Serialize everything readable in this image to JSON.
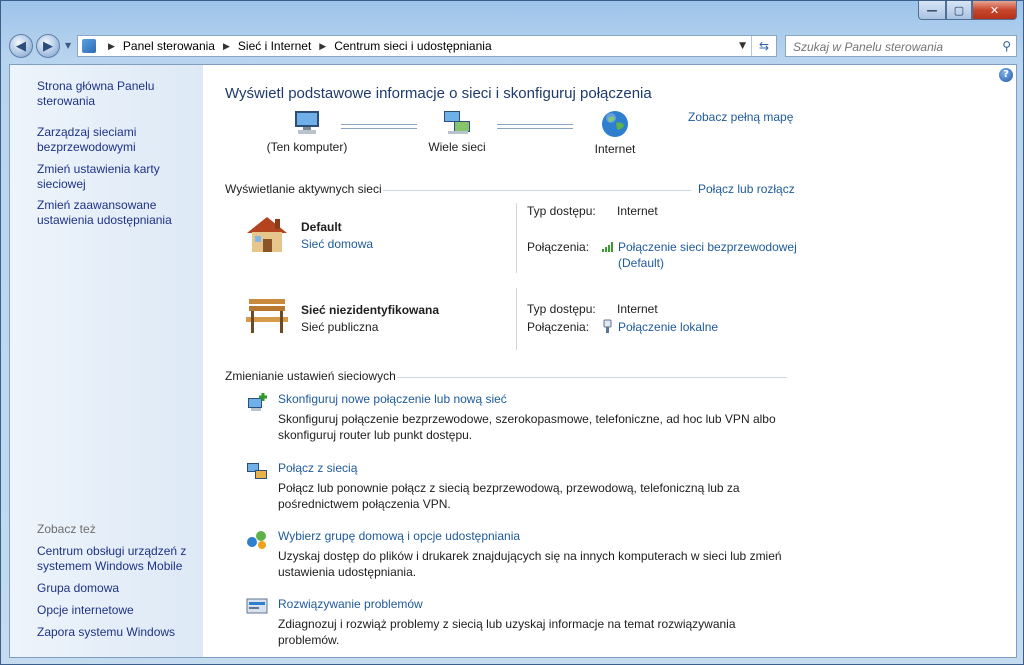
{
  "window": {
    "buttons": {
      "minimize": "—",
      "maximize": "▢",
      "close": "✕"
    }
  },
  "address": {
    "crumbs": [
      "Panel sterowania",
      "Sieć i Internet",
      "Centrum sieci i udostępniania"
    ]
  },
  "search": {
    "placeholder": "Szukaj w Panelu sterowania"
  },
  "sidebar": {
    "links": [
      "Strona główna Panelu sterowania",
      "Zarządzaj sieciami bezprzewodowymi",
      "Zmień ustawienia karty sieciowej",
      "Zmień zaawansowane ustawienia udostępniania"
    ],
    "see_also_label": "Zobacz też",
    "see_also": [
      "Centrum obsługi urządzeń z systemem Windows Mobile",
      "Grupa domowa",
      "Opcje internetowe",
      "Zapora systemu Windows"
    ]
  },
  "main": {
    "title": "Wyświetl podstawowe informacje o sieci i skonfiguruj połączenia",
    "full_map": "Zobacz pełną mapę",
    "map": {
      "computer": "(Ten komputer)",
      "networks": "Wiele sieci",
      "internet": "Internet"
    },
    "active_header": "Wyświetlanie aktywnych sieci",
    "connect_link": "Połącz lub rozłącz",
    "networks": [
      {
        "name": "Default",
        "type": "Sieć domowa",
        "access_label": "Typ dostępu:",
        "access": "Internet",
        "conn_label": "Połączenia:",
        "conn": "Połączenie sieci bezprzewodowej",
        "conn2": "(Default)"
      },
      {
        "name": "Sieć niezidentyfikowana",
        "type": "Sieć publiczna",
        "access_label": "Typ dostępu:",
        "access": "Internet",
        "conn_label": "Połączenia:",
        "conn": "Połączenie lokalne"
      }
    ],
    "change_header": "Zmienianie ustawień sieciowych",
    "tasks": [
      {
        "link": "Skonfiguruj nowe połączenie lub nową sieć",
        "desc": "Skonfiguruj połączenie bezprzewodowe, szerokopasmowe, telefoniczne, ad hoc lub VPN albo skonfiguruj router lub punkt dostępu."
      },
      {
        "link": "Połącz z siecią",
        "desc": "Połącz lub ponownie połącz z siecią bezprzewodową, przewodową, telefoniczną lub za pośrednictwem połączenia VPN."
      },
      {
        "link": "Wybierz grupę domową i opcje udostępniania",
        "desc": "Uzyskaj dostęp do plików i drukarek znajdujących się na innych komputerach w sieci lub zmień ustawienia udostępniania."
      },
      {
        "link": "Rozwiązywanie problemów",
        "desc": "Zdiagnozuj i rozwiąż problemy z siecią lub uzyskaj informacje na temat rozwiązywania problemów."
      }
    ]
  }
}
